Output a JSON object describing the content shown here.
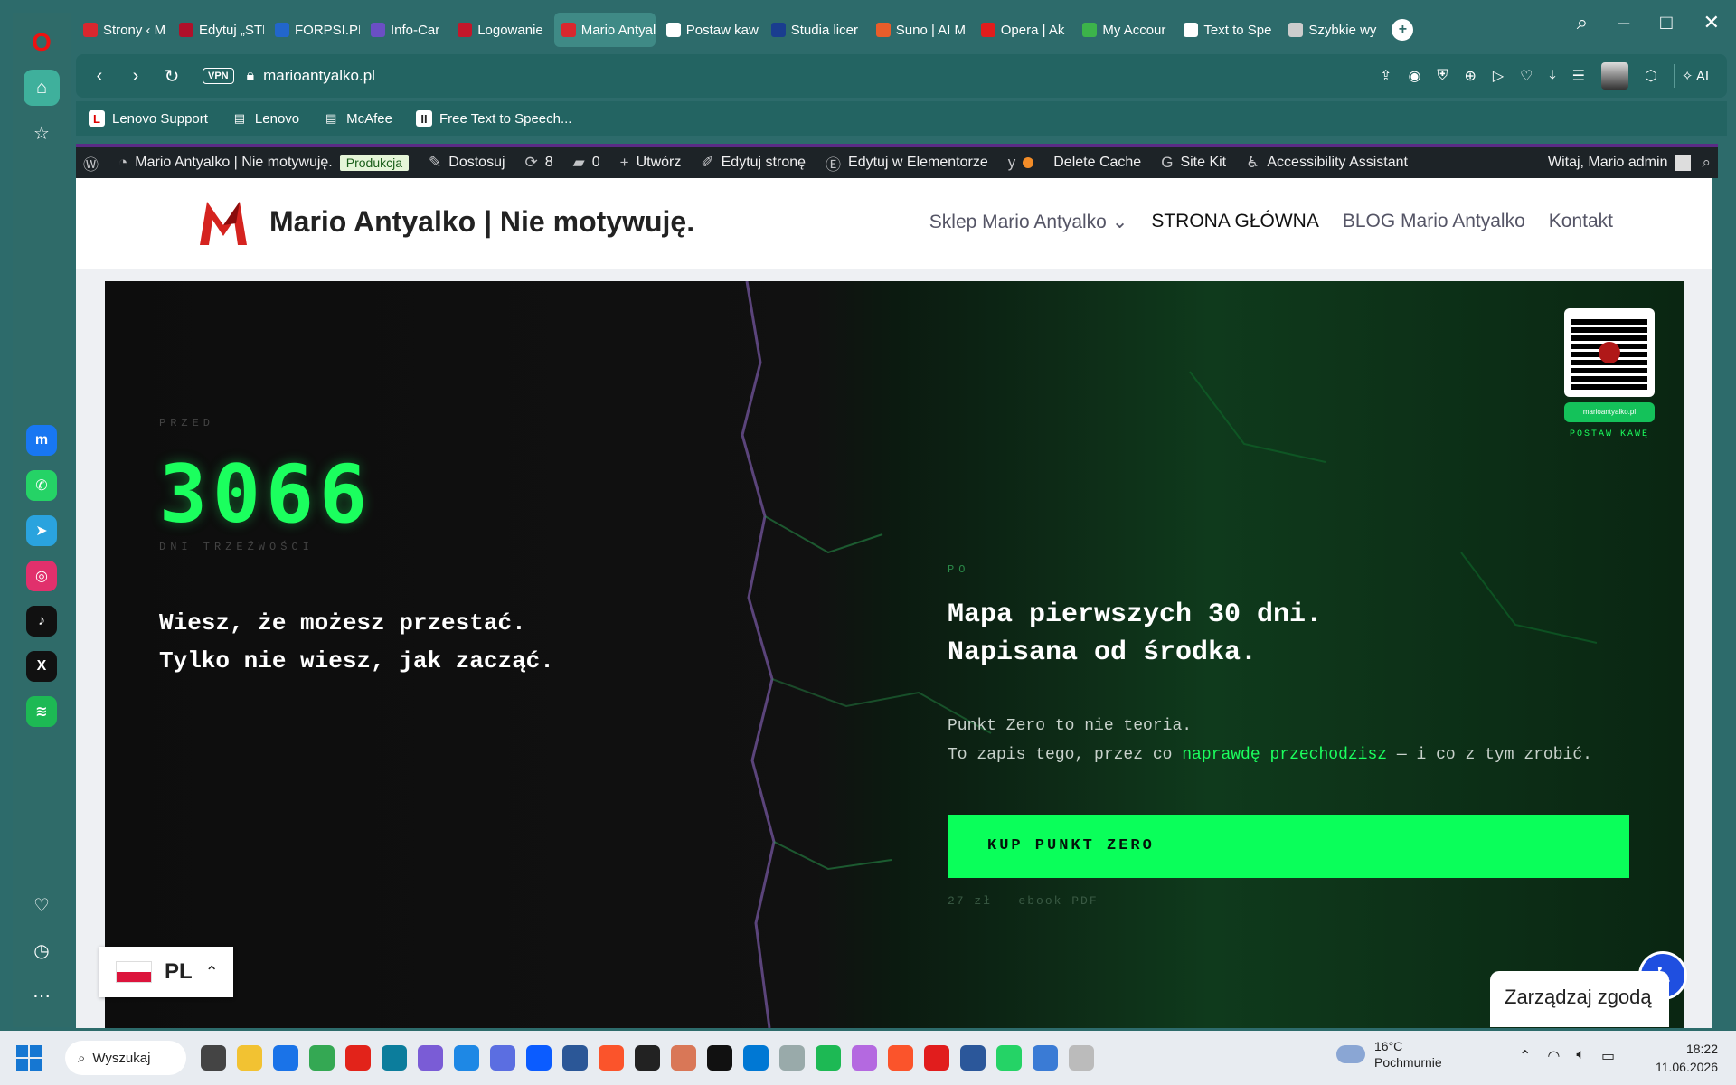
{
  "browser": {
    "tabs": [
      {
        "label": "Strony ‹ M",
        "color": "#d9272e"
      },
      {
        "label": "Edytuj „STF",
        "color": "#b0102a"
      },
      {
        "label": "FORPSI.PL",
        "color": "#2266cc"
      },
      {
        "label": "Info-Car",
        "color": "#6b4fc4"
      },
      {
        "label": "Logowanie",
        "color": "#c4162a"
      },
      {
        "label": "Mario Antyalko - Tr",
        "color": "#d9272e"
      },
      {
        "label": "Postaw kaw",
        "color": "#ffffff"
      },
      {
        "label": "Studia licer",
        "color": "#1a3d8f"
      },
      {
        "label": "Suno | AI M",
        "color": "#e85d2a"
      },
      {
        "label": "Opera | Ak",
        "color": "#e11d1d"
      },
      {
        "label": "My Accour",
        "color": "#3cb44a"
      },
      {
        "label": "Text to Spe",
        "color": "#ffffff"
      },
      {
        "label": "Szybkie wy",
        "color": "#cccccc"
      }
    ],
    "url": "marioantyalko.pl",
    "vpn_label": "VPN",
    "ai_label": "AI",
    "bookmarks": [
      {
        "label": "Lenovo Support",
        "icon": "L"
      },
      {
        "label": "Lenovo",
        "icon": "doc-icon"
      },
      {
        "label": "McAfee",
        "icon": "doc-icon"
      },
      {
        "label": "Free Text to Speech...",
        "icon": "II"
      }
    ]
  },
  "wp_admin": {
    "site_name": "Mario Antyalko | Nie motywuję.",
    "env_badge": "Produkcja",
    "customize": "Dostosuj",
    "updates": "8",
    "comments": "0",
    "new": "Utwórz",
    "edit_page": "Edytuj stronę",
    "edit_elementor": "Edytuj w Elementorze",
    "delete_cache": "Delete Cache",
    "site_kit": "Site Kit",
    "accessibility": "Accessibility Assistant",
    "greeting": "Witaj, Mario admin"
  },
  "site": {
    "title": "Mario Antyalko | Nie motywuję.",
    "menu": [
      "Sklep Mario Antyalko",
      "STRONA GŁÓWNA",
      "BLOG Mario Antyalko",
      "Kontakt"
    ]
  },
  "hero": {
    "before_label": "PRZED",
    "counter": "3066",
    "counter_label": "DNI TRZEŹWOŚCI",
    "left_line1": "Wiesz, że możesz przestać.",
    "left_line2": "Tylko nie wiesz, jak zacząć.",
    "after_label": "PO",
    "right_line1": "Mapa pierwszych 30 dni.",
    "right_line2": "Napisana od środka.",
    "body_line1": "Punkt Zero to nie teoria.",
    "body_line2_pre": "To zapis tego, przez co ",
    "body_line2_hl": "naprawdę przechodzisz",
    "body_line2_post": " — i co z tym zrobić.",
    "cta": "KUP PUNKT ZERO",
    "price": "27 zł — ebook PDF",
    "qr_url": "marioantyalko.pl",
    "qr_caption": "POSTAW KAWĘ"
  },
  "widgets": {
    "lang_code": "PL",
    "consent": "Zarządzaj zgodą"
  },
  "taskbar": {
    "search": "Wyszukaj",
    "weather_temp": "16°C",
    "weather_desc": "Pochmurnie",
    "time": "18:22",
    "date": "11.06.2026"
  },
  "colors": {
    "accent_green": "#1bff5e",
    "cta_green": "#0aff5a",
    "browser_teal": "#2f6b69",
    "wp_bar": "#1d2327"
  }
}
